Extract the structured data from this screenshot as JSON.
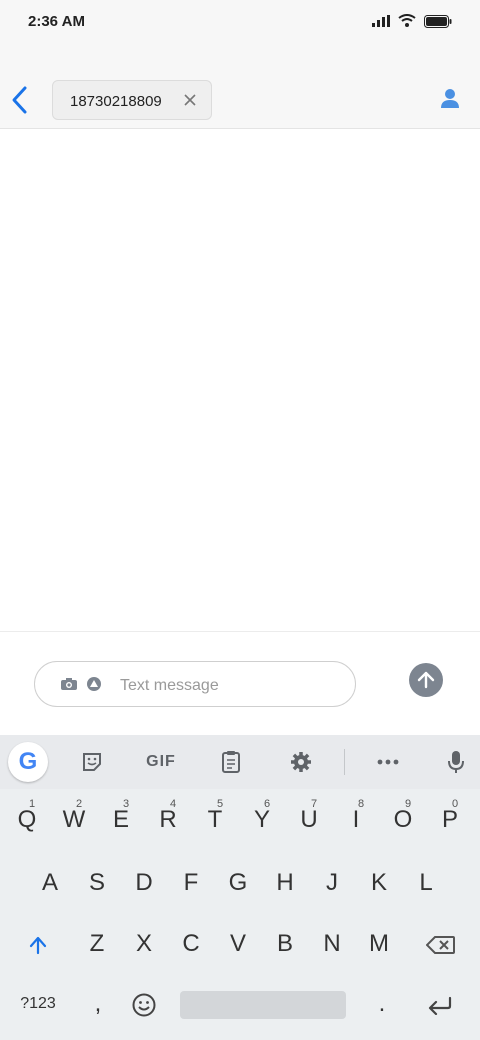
{
  "status_bar": {
    "time": "2:36 AM"
  },
  "header": {
    "recipient": "18730218809"
  },
  "compose": {
    "placeholder": "Text message"
  },
  "keyboard": {
    "toolbar": {
      "gif_label": "GIF",
      "google_label": "G"
    },
    "row1": [
      {
        "key": "Q",
        "hint": "1"
      },
      {
        "key": "W",
        "hint": "2"
      },
      {
        "key": "E",
        "hint": "3"
      },
      {
        "key": "R",
        "hint": "4"
      },
      {
        "key": "T",
        "hint": "5"
      },
      {
        "key": "Y",
        "hint": "6"
      },
      {
        "key": "U",
        "hint": "7"
      },
      {
        "key": "I",
        "hint": "8"
      },
      {
        "key": "O",
        "hint": "9"
      },
      {
        "key": "P",
        "hint": "0"
      }
    ],
    "row2": [
      "A",
      "S",
      "D",
      "F",
      "G",
      "H",
      "J",
      "K",
      "L"
    ],
    "row3": [
      "Z",
      "X",
      "C",
      "V",
      "B",
      "N",
      "M"
    ],
    "row4": {
      "symbols": "?123",
      "comma": ",",
      "period": "."
    }
  },
  "colors": {
    "accent": "#1a73e8",
    "send_button": "#7d8590",
    "keyboard_bg": "#eceff1"
  }
}
